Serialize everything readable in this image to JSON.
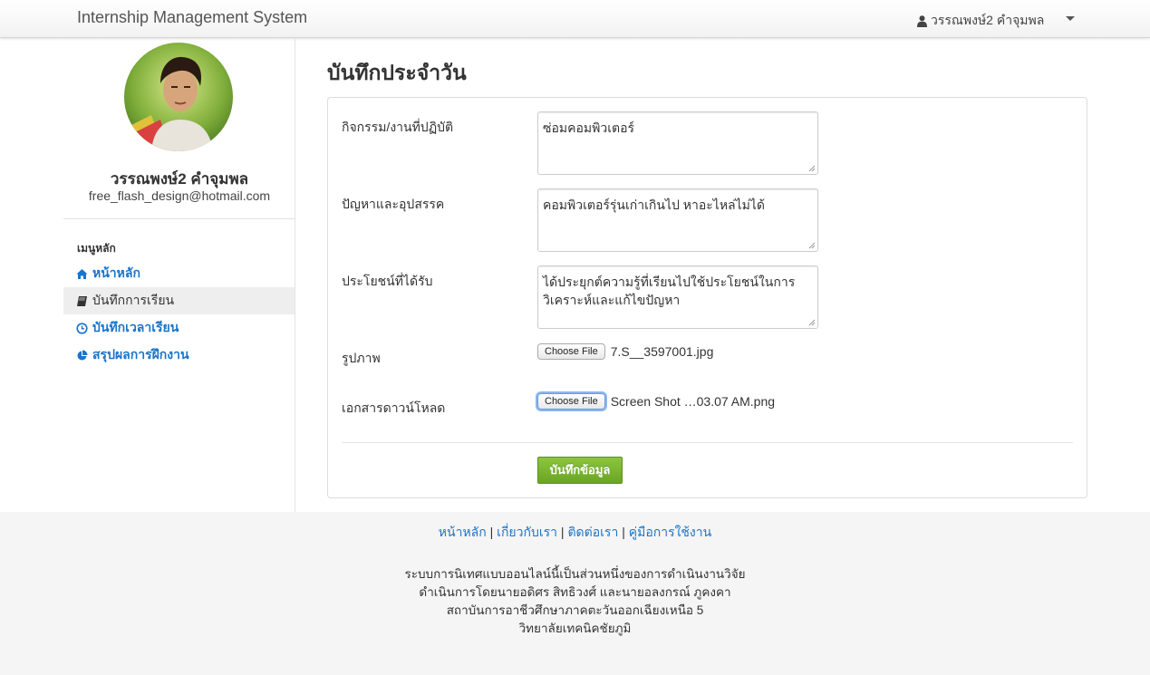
{
  "navbar": {
    "brand": "Internship Management System",
    "user_name": "วรรณพงษ์2 คำจุมพล"
  },
  "sidebar": {
    "profile_name": "วรรณพงษ์2 คำจุมพล",
    "profile_email": "free_flash_design@hotmail.com",
    "menu_header": "เมนูหลัก",
    "items": [
      {
        "label": "หน้าหลัก",
        "icon": "home-icon"
      },
      {
        "label": "บันทึกการเรียน",
        "icon": "book-icon"
      },
      {
        "label": "บันทึกเวลาเรียน",
        "icon": "clock-icon"
      },
      {
        "label": "สรุปผลการฝึกงาน",
        "icon": "pie-chart-icon"
      }
    ]
  },
  "main": {
    "title": "บันทึกประจำวัน",
    "fields": {
      "activity_label": "กิจกรรม/งานที่ปฏิบัติ",
      "activity_value": "ซ่อมคอมพิวเตอร์",
      "problem_label": "ปัญหาและอุปสรรค",
      "problem_value": "คอมพิวเตอร์รุ่นเก่าเกินไป หาอะไหล่ไม่ได้",
      "benefit_label": "ประโยชน์ที่ได้รับ",
      "benefit_value": "ได้ประยุกต์ความรู้ที่เรียนไปใช้ประโยชน์ในการวิเคราะห์และแก้ไขปัญหา",
      "image_label": "รูปภาพ",
      "image_button": "Choose File",
      "image_file": "7.S__3597001.jpg",
      "document_label": "เอกสารดาวน์โหลด",
      "document_button": "Choose File",
      "document_file": "Screen Shot …03.07 AM.png"
    },
    "submit_label": "บันทึกข้อมูล"
  },
  "footer": {
    "links": [
      "หน้าหลัก",
      "เกี่ยวกับเรา",
      "ติดต่อเรา",
      "คู่มือการใช้งาน"
    ],
    "separator": "|",
    "lines": [
      "ระบบการนิเทศแบบออนไลน์นี้เป็นส่วนหนึ่งของการดำเนินงานวิจัย",
      "ดำเนินการโดยนายอดิศร สิทธิวงศ์ และนายอลงกรณ์ ภูคงคา",
      "สถาบันการอาชีวศึกษาภาคตะวันออกเฉียงเหนือ 5",
      "วิทยาลัยเทคนิคชัยภูมิ"
    ]
  },
  "colors": {
    "link": "#1a74c9",
    "submit": "#7ab530",
    "footer_bg": "#f5f5f5"
  }
}
